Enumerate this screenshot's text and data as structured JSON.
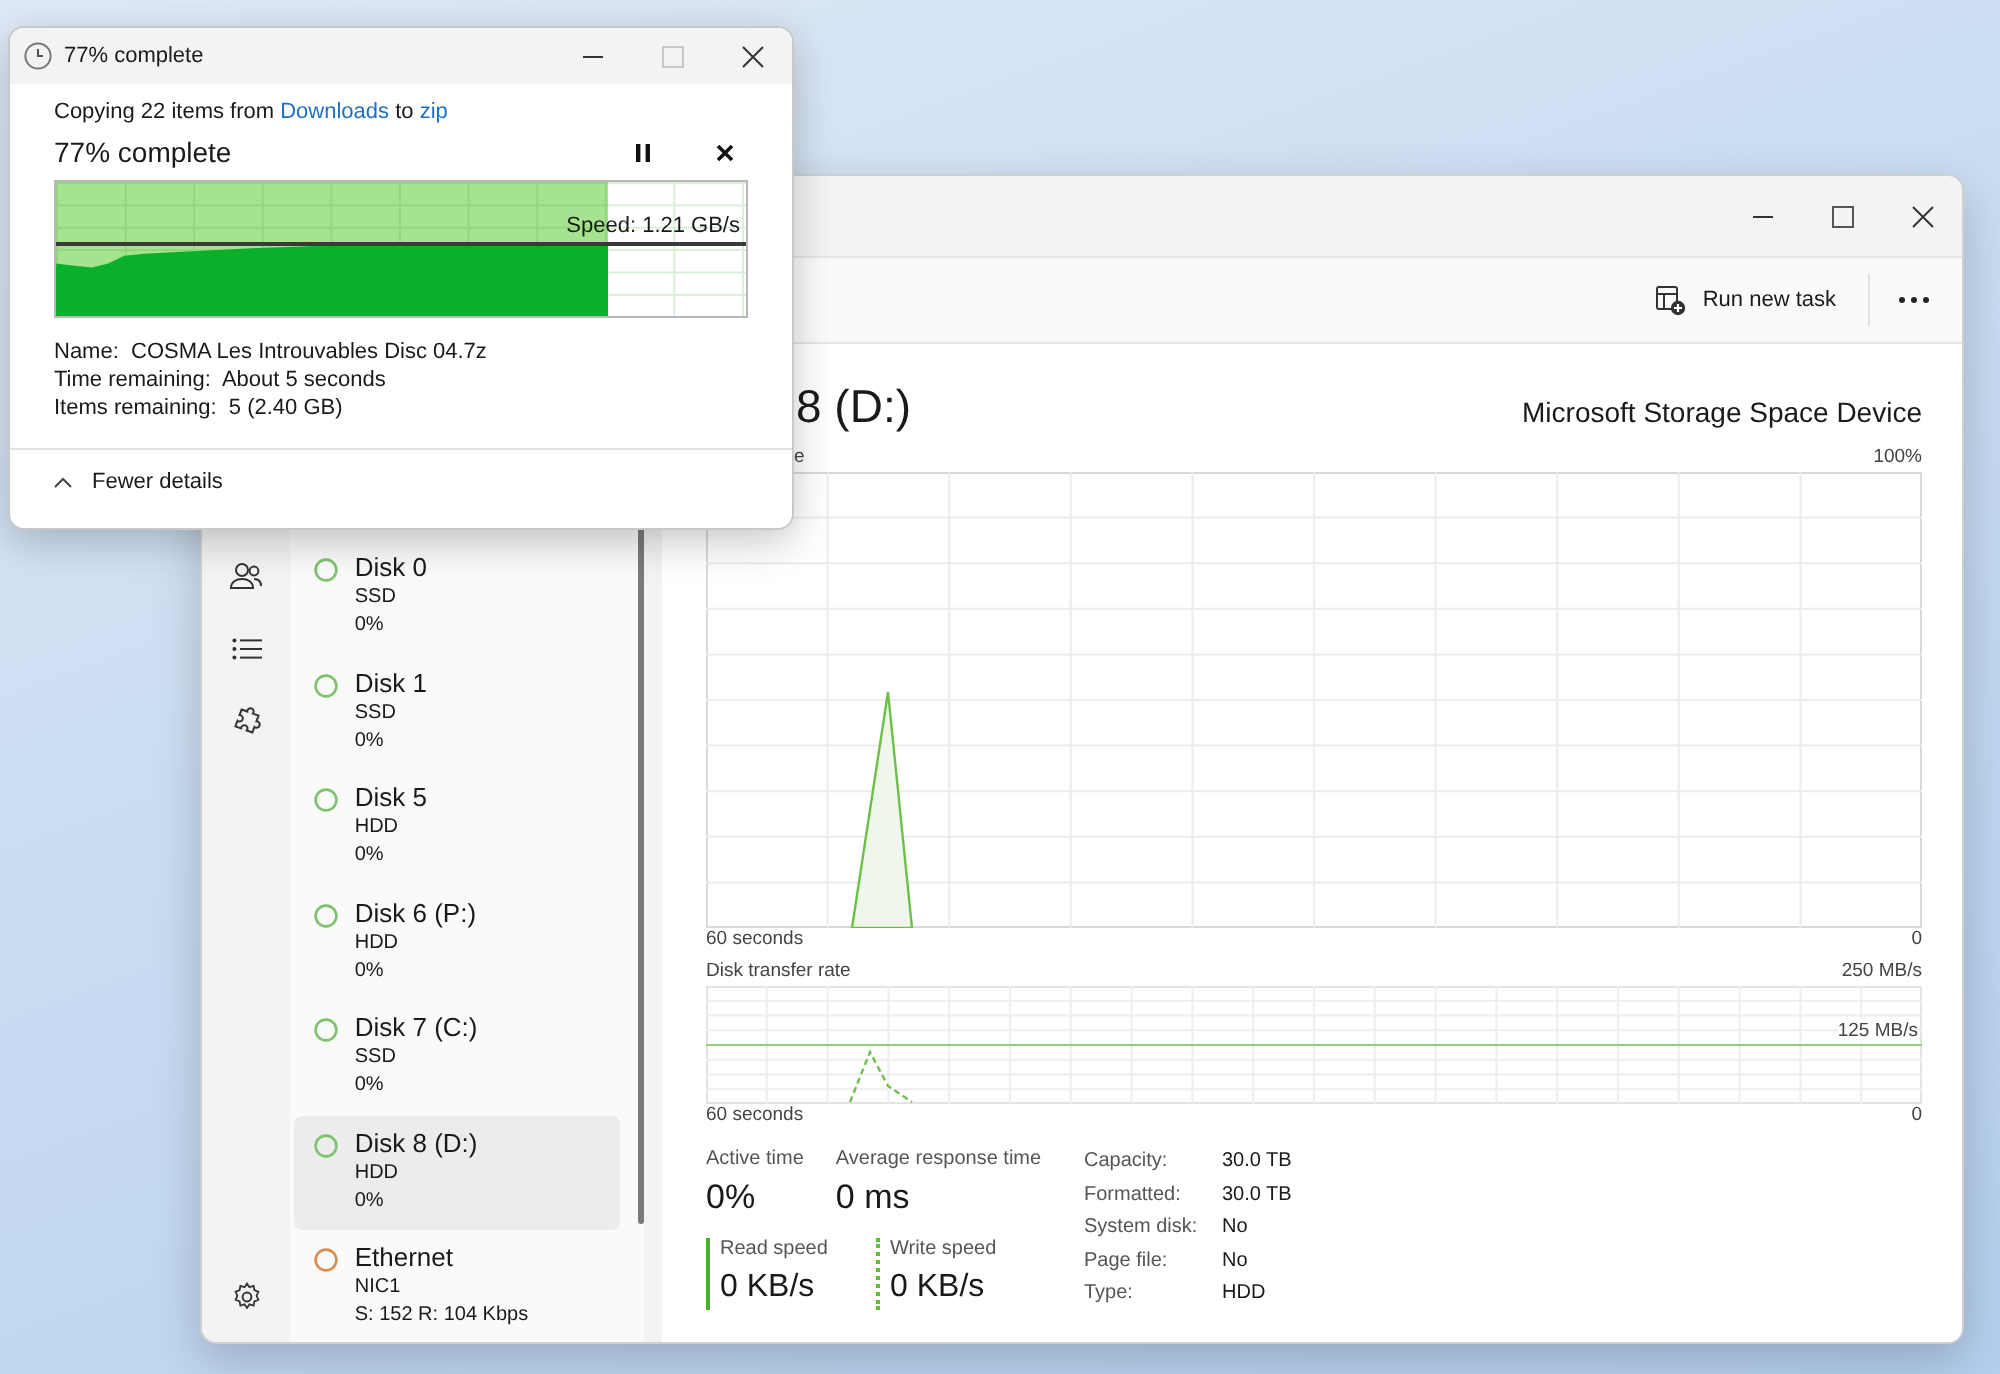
{
  "copy_dialog": {
    "title": "77% complete",
    "summary": {
      "prefix": "Copying 22 items from",
      "source": "Downloads",
      "middle": "to",
      "destination": "zip"
    },
    "status": "77% complete",
    "progress": {
      "level": 0.8
    },
    "speed": "Speed: 1.21 GB/s",
    "details": [
      {
        "label": "Name:",
        "value": "COSMA Les Introuvables Disc 04.7z"
      },
      {
        "label": "Time remaining:",
        "value": "About 5 seconds"
      },
      {
        "label": "Items remaining:",
        "value": "5 (2.40 GB)"
      }
    ],
    "toggle": "Fewer details"
  },
  "task_manager": {
    "toolbar": {
      "run_task": "Run new task"
    },
    "devices": [
      {
        "name": "Disk 0",
        "type": "SSD",
        "usage": "0%",
        "color": "#7cc36b",
        "selected": false
      },
      {
        "name": "Disk 1",
        "type": "SSD",
        "usage": "0%",
        "color": "#7cc36b",
        "selected": false
      },
      {
        "name": "Disk 5",
        "type": "HDD",
        "usage": "0%",
        "color": "#7cc36b",
        "selected": false
      },
      {
        "name": "Disk 6 (P:)",
        "type": "HDD",
        "usage": "0%",
        "color": "#7cc36b",
        "selected": false
      },
      {
        "name": "Disk 7 (C:)",
        "type": "SSD",
        "usage": "0%",
        "color": "#7cc36b",
        "selected": false
      },
      {
        "name": "Disk 8 (D:)",
        "type": "HDD",
        "usage": "0%",
        "color": "#7cc36b",
        "selected": true
      },
      {
        "name": "Ethernet",
        "type": "NIC1",
        "usage": "S: 152 R: 104 Kbps",
        "color": "#d98c4e",
        "selected": false
      }
    ],
    "detail": {
      "title": "8 (D:)",
      "model": "Microsoft Storage Space Device",
      "chart1": {
        "label": "e",
        "max": "100%",
        "time": "60 seconds",
        "min": "0"
      },
      "chart2": {
        "label": "Disk transfer rate",
        "max": "250 MB/s",
        "mid": "125 MB/s",
        "time": "60 seconds",
        "min": "0"
      },
      "stats": [
        {
          "label": "Active time",
          "value": "0%"
        },
        {
          "label": "Average response time",
          "value": "0 ms"
        }
      ],
      "speeds": [
        {
          "label": "Read speed",
          "value": "0 KB/s",
          "kind": "solid"
        },
        {
          "label": "Write speed",
          "value": "0 KB/s",
          "kind": "dashed"
        }
      ],
      "properties": [
        {
          "label": "Capacity:",
          "value": "30.0 TB"
        },
        {
          "label": "Formatted:",
          "value": "30.0 TB"
        },
        {
          "label": "System disk:",
          "value": "No"
        },
        {
          "label": "Page file:",
          "value": "No"
        },
        {
          "label": "Type:",
          "value": "HDD"
        }
      ]
    }
  }
}
